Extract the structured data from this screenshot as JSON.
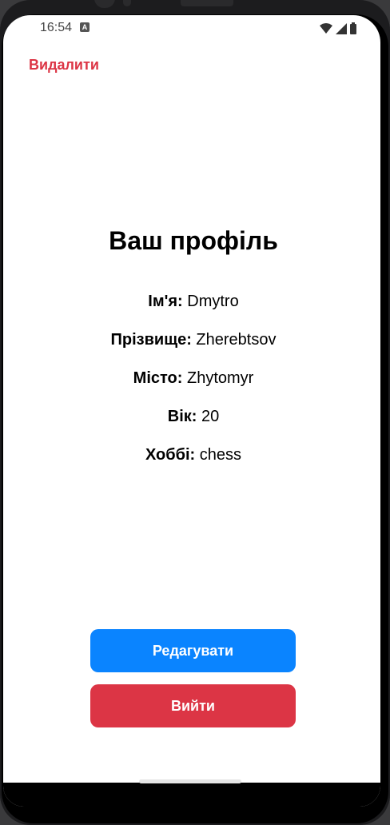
{
  "status_bar": {
    "time": "16:54"
  },
  "header": {
    "delete_label": "Видалити"
  },
  "profile": {
    "title": "Ваш профіль",
    "fields": [
      {
        "label": "Ім'я:",
        "value": "Dmytro"
      },
      {
        "label": "Прізвище:",
        "value": "Zherebtsov"
      },
      {
        "label": "Місто:",
        "value": "Zhytomyr"
      },
      {
        "label": "Вік:",
        "value": "20"
      },
      {
        "label": "Хоббі:",
        "value": "chess"
      }
    ]
  },
  "actions": {
    "edit_label": "Редагувати",
    "logout_label": "Вийти"
  },
  "colors": {
    "danger": "#dc3545",
    "primary": "#0a84ff"
  }
}
